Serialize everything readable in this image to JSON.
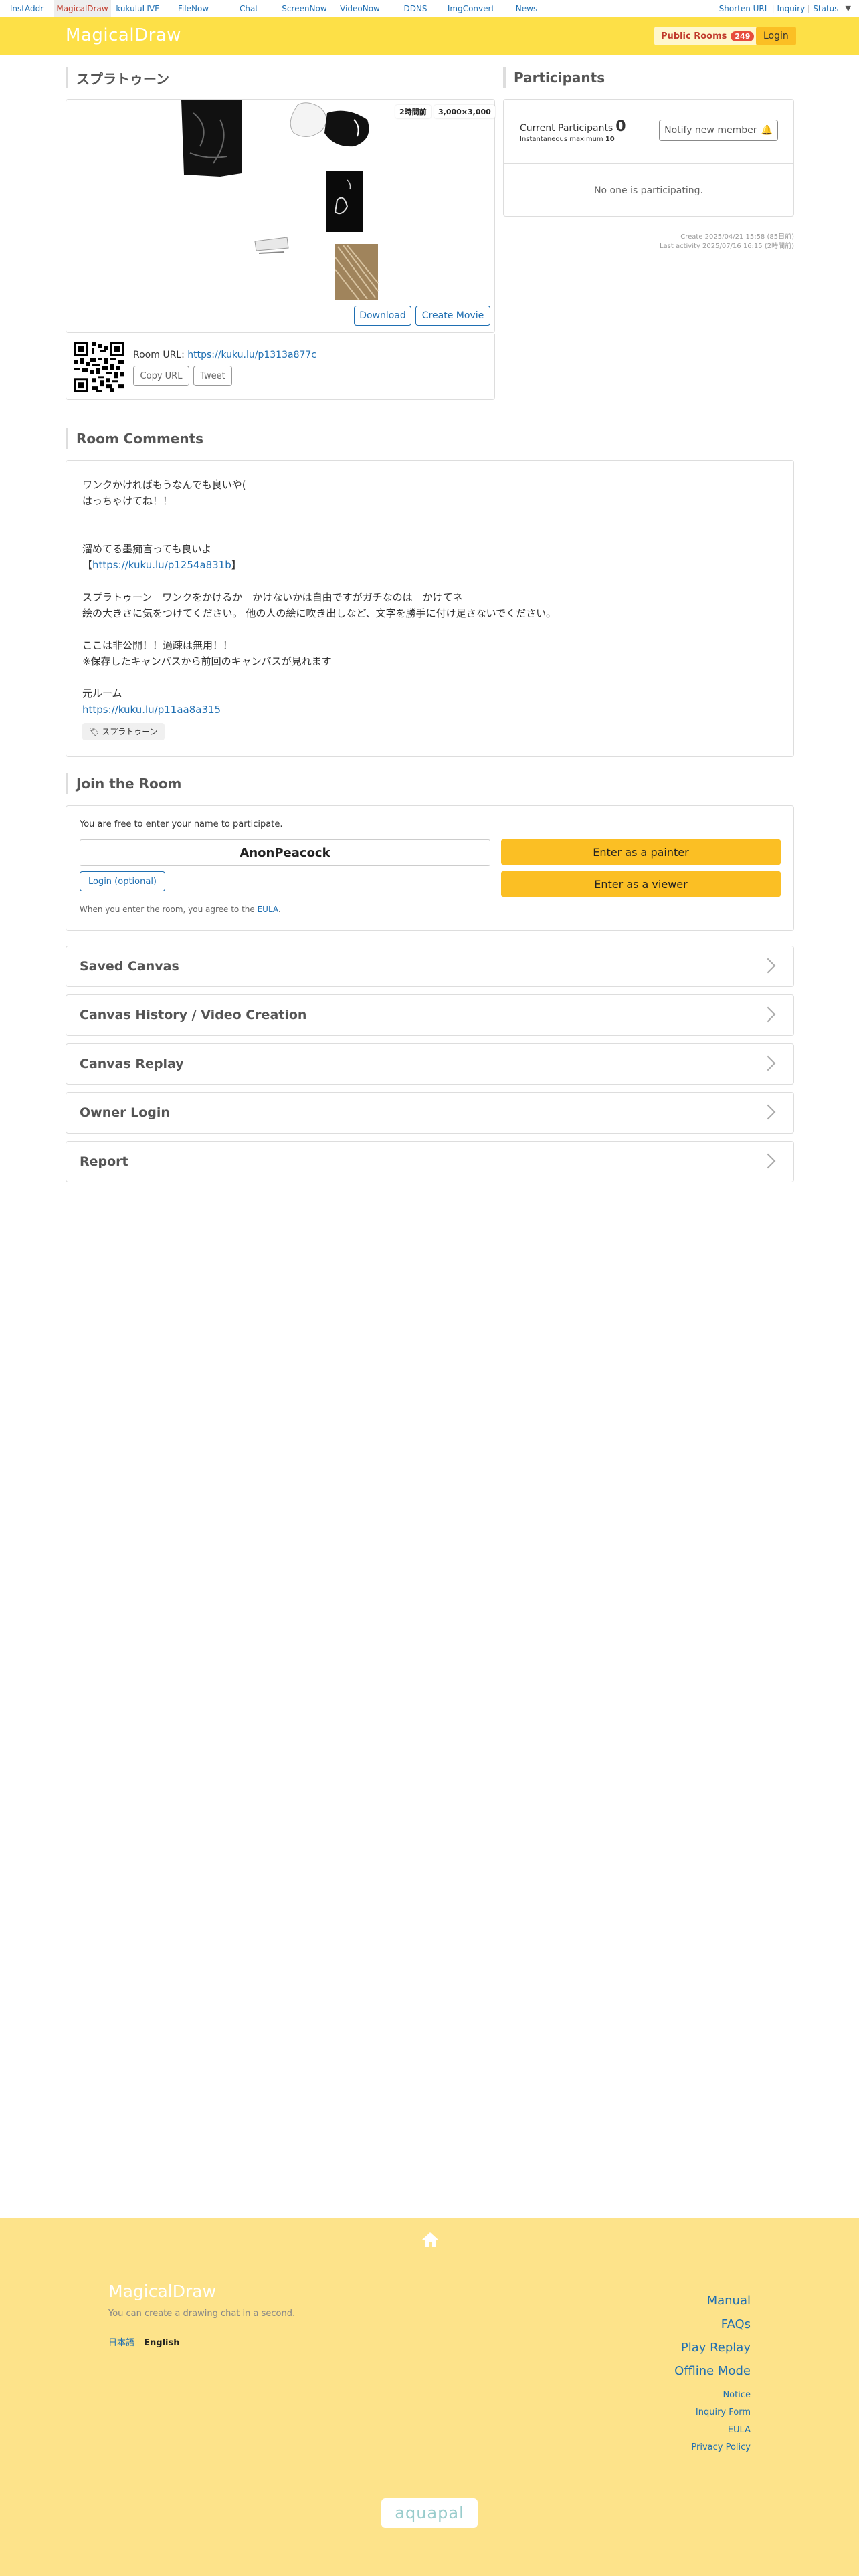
{
  "topnav": {
    "items": [
      {
        "label": "InstAddr",
        "active": false
      },
      {
        "label": "MagicalDraw",
        "active": true
      },
      {
        "label": "kukuluLIVE",
        "active": false
      },
      {
        "label": "FileNow",
        "active": false
      },
      {
        "label": "Chat",
        "active": false
      },
      {
        "label": "ScreenNow",
        "active": false
      },
      {
        "label": "VideoNow",
        "active": false
      },
      {
        "label": "DDNS",
        "active": false
      },
      {
        "label": "ImgConvert",
        "active": false
      },
      {
        "label": "News",
        "active": false
      }
    ],
    "right": {
      "shorten_url": "Shorten URL",
      "inquiry": "Inquiry",
      "status": "Status",
      "sep": "|"
    }
  },
  "header": {
    "logo": "MagicalDraw",
    "public_rooms_label": "Public Rooms",
    "public_rooms_count": "249",
    "login_label": "Login"
  },
  "room": {
    "title": "スプラトゥーン",
    "time_badge": "2時間前",
    "size_badge": "3,000×3,000",
    "download_label": "Download",
    "create_movie_label": "Create Movie",
    "room_url_label": "Room URL: ",
    "room_url": "https://kuku.lu/p1313a877c",
    "copy_url_label": "Copy URL",
    "tweet_label": "Tweet"
  },
  "participants": {
    "title": "Participants",
    "current_label": "Current Participants",
    "current_value": "0",
    "max_label": "Instantaneous maximum",
    "max_value": "10",
    "notify_label": "Notify new member",
    "empty_text": "No one is participating.",
    "created": "Create 2025/04/21 15:58 (85日前)",
    "last_activity": "Last activity 2025/07/16 16:15 (2時間前)"
  },
  "comments": {
    "title": "Room Comments",
    "line1": "ワンクかければもうなんでも良いや(",
    "line2": "はっちゃけてね！！",
    "line3": "溜めてる墨痴言っても良いよ",
    "line4_pre": "【",
    "line4_link": "https://kuku.lu/p1254a831b",
    "line4_post": "】",
    "line5": "スプラトゥーン　ワンクをかけるか　かけないかは自由ですがガチなのは　かけてネ",
    "line6": "絵の大きさに気をつけてください。 他の人の絵に吹き出しなど、文字を勝手に付け足さないでください。",
    "line7": "ここは非公開！！過疎は無用！！",
    "line8": "※保存したキャンバスから前回のキャンバスが見れます",
    "line9": "元ルーム",
    "line10_link": "https://kuku.lu/p11aa8a315",
    "tag": "スプラトゥーン"
  },
  "join": {
    "title": "Join the Room",
    "intro": "You are free to enter your name to participate.",
    "name": "AnonPeacock",
    "login_optional": "Login (optional)",
    "enter_painter": "Enter as a painter",
    "enter_viewer": "Enter as a viewer",
    "eula_pre": "When you enter the room, you agree to the ",
    "eula_link": "EULA",
    "eula_post": "."
  },
  "accordions": [
    {
      "label": "Saved Canvas"
    },
    {
      "label": "Canvas History / Video Creation"
    },
    {
      "label": "Canvas Replay"
    },
    {
      "label": "Owner Login"
    },
    {
      "label": "Report"
    }
  ],
  "footer": {
    "logo": "MagicalDraw",
    "tagline": "You can create a drawing chat in a second.",
    "lang_ja": "日本語",
    "lang_en": "English",
    "links_big": [
      "Manual",
      "FAQs",
      "Play Replay",
      "Offline Mode"
    ],
    "links_small": [
      "Notice",
      "Inquiry Form",
      "EULA",
      "Privacy Policy"
    ],
    "brand": "aquapal"
  },
  "colors": {
    "accent_yellow": "#fde047",
    "button_yellow": "#fbbf24",
    "link_blue": "#1f6fb2",
    "footer_bg": "#fde38a"
  }
}
